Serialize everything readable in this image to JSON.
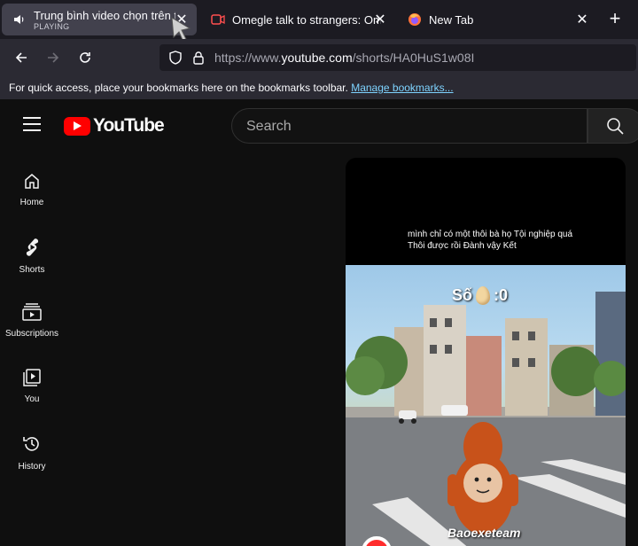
{
  "browser": {
    "tabs": [
      {
        "title": "Trung bình video chọn trên tik",
        "subtitle": "PLAYING",
        "active": true
      },
      {
        "title": "Omegle talk to strangers: Omeg",
        "active": false
      },
      {
        "title": "New Tab",
        "active": false
      }
    ],
    "url_prefix": "https://www.",
    "url_host": "youtube.com",
    "url_path": "/shorts/HA0HuS1w08I",
    "bookmarks_message": "For quick access, place your bookmarks here on the bookmarks toolbar.",
    "bookmarks_link": "Manage bookmarks..."
  },
  "youtube": {
    "logo_text": "YouTube",
    "search_placeholder": "Search",
    "guide": [
      "Home",
      "Shorts",
      "Subscriptions",
      "You",
      "History"
    ],
    "short": {
      "caption": "mình chỉ có một thôi bà họ Tội nghiệp quá Thôi được rồi Đành vậy Kết",
      "score_label": "Số",
      "score_value": ":0",
      "watermark": "Baoexeteam"
    }
  },
  "colors": {
    "brand_red": "#ff0000",
    "link": "#7ed3ff",
    "tab_active": "#42414d"
  }
}
